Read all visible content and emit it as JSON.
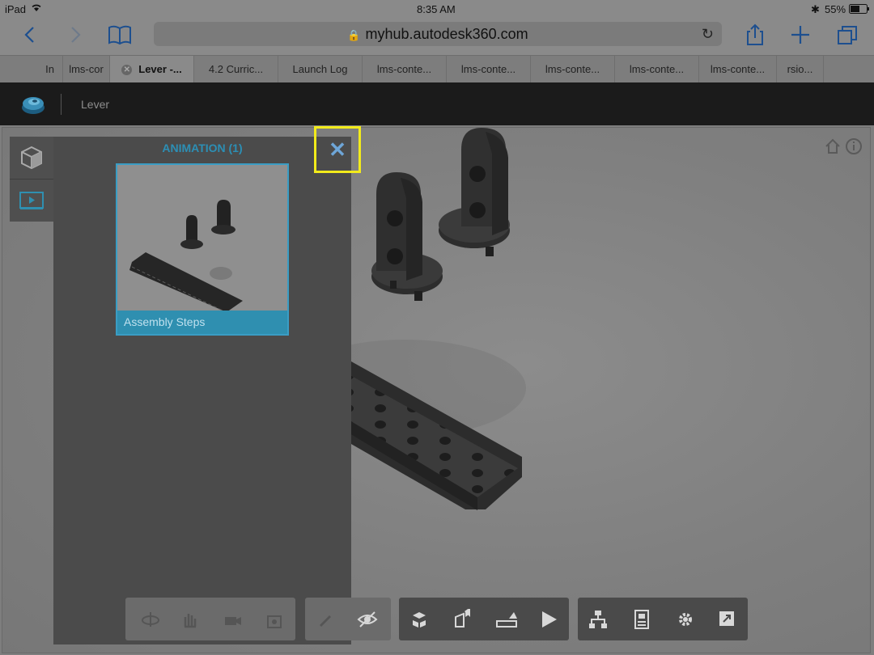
{
  "status": {
    "device": "iPad",
    "time": "8:35 AM",
    "battery": "55%"
  },
  "browser": {
    "url": "myhub.autodesk360.com",
    "tabs": [
      {
        "label": "In"
      },
      {
        "label": "lms-cor"
      },
      {
        "label": "Lever -..."
      },
      {
        "label": "4.2 Curric..."
      },
      {
        "label": "Launch Log"
      },
      {
        "label": "lms-conte..."
      },
      {
        "label": "lms-conte..."
      },
      {
        "label": "lms-conte..."
      },
      {
        "label": "lms-conte..."
      },
      {
        "label": "lms-conte..."
      },
      {
        "label": "rsio..."
      }
    ],
    "icons": [
      "back-icon",
      "forward-icon",
      "bookmarks-icon",
      "reload-icon",
      "share-icon",
      "add-tab-icon",
      "tabs-icon"
    ]
  },
  "app": {
    "title": "Lever"
  },
  "panel": {
    "header": "ANIMATION (1)",
    "card_label": "Assembly Steps",
    "close_glyph": "✕"
  },
  "colors": {
    "accent": "#2f8fb0",
    "highlight": "#f2eb1b",
    "header_bg": "#1b1b1b"
  },
  "toolbar": {
    "groups": [
      {
        "name": "navigation",
        "items": [
          "orbit-icon",
          "pan-icon",
          "camera-icon",
          "fit-icon"
        ],
        "disabled": true
      },
      {
        "name": "markup",
        "items": [
          "pencil-icon",
          "visibility-icon"
        ]
      },
      {
        "name": "model",
        "items": [
          "explode-icon",
          "section-icon",
          "measure-icon",
          "play-icon"
        ]
      },
      {
        "name": "settings",
        "items": [
          "structure-icon",
          "properties-icon",
          "settings-icon",
          "fullscreen-icon"
        ]
      }
    ]
  }
}
